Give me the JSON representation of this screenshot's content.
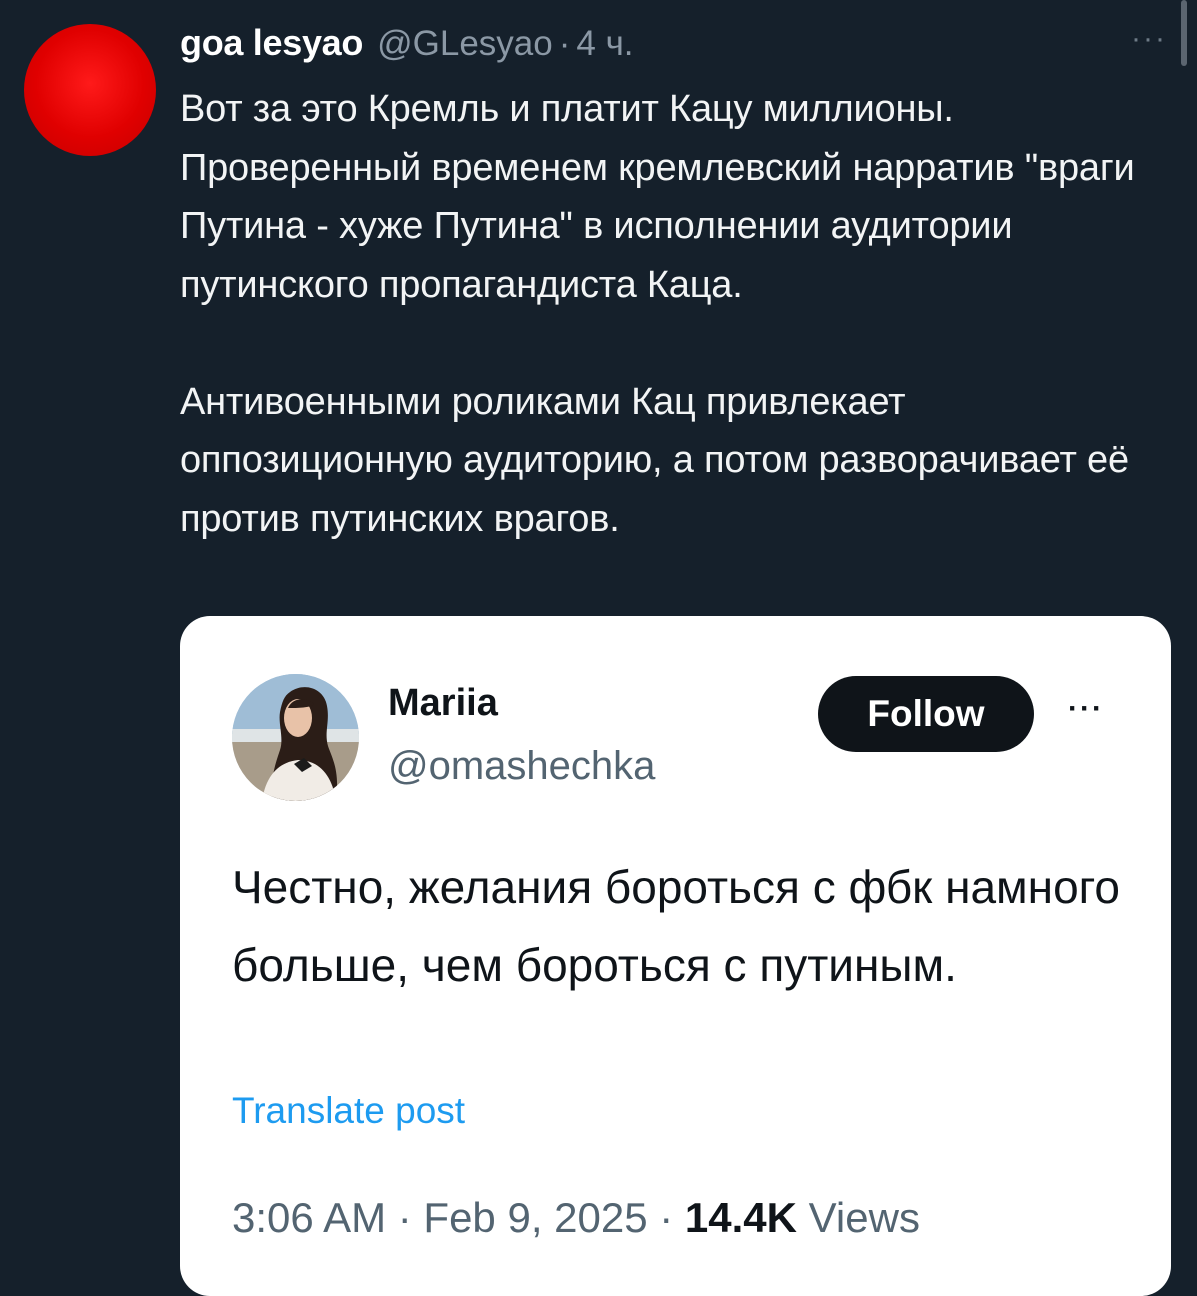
{
  "post": {
    "display_name": "goa lesyao",
    "handle": "@GLesyao",
    "separator": "·",
    "time": "4 ч.",
    "more_icon": "···",
    "avatar_color": "#e00000",
    "paragraphs": [
      "Вот за это Кремль и платит Кацу миллионы. Проверенный временем кремлевский нарратив \"враги Путина - хуже Путина\" в исполнении аудитории путинского пропагандиста Каца.",
      "Антивоенными роликами Кац привлекает оппозиционную аудиторию, а потом разворачивает её против путинских врагов."
    ]
  },
  "quoted": {
    "name": "Mariia",
    "username": "@omashechka",
    "follow_label": "Follow",
    "more_icon": "···",
    "text": "Честно, желания бороться с фбк намного больше, чем бороться с путиным.",
    "translate_label": "Translate post",
    "timestamp": "3:06 AM · Feb 9, 2025 · ",
    "views_count": "14.4K",
    "views_label": " Views"
  },
  "colors": {
    "background": "#15202b",
    "link": "#1d9bf0",
    "muted_dark": "#8b98a5",
    "muted_light": "#536471"
  }
}
